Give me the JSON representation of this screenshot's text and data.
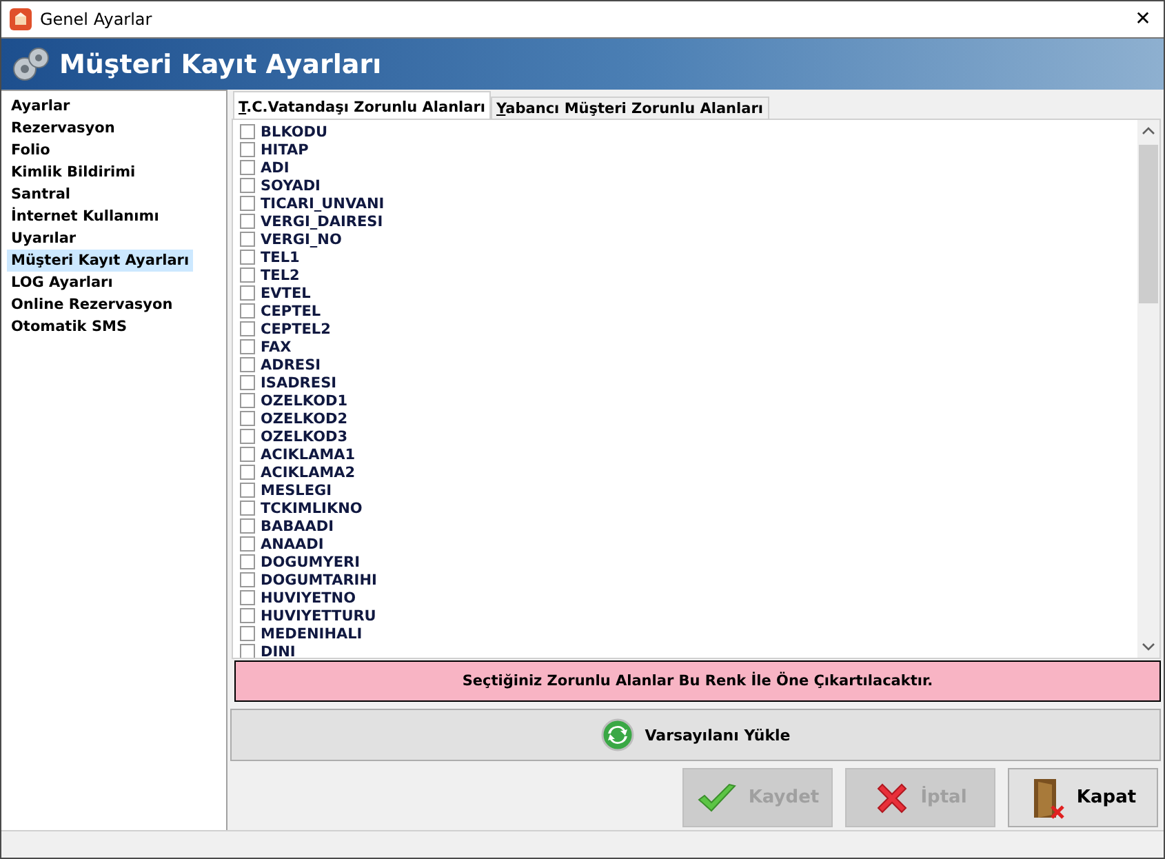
{
  "window": {
    "title": "Genel Ayarlar",
    "close": "✕"
  },
  "header": {
    "title": "Müşteri Kayıt Ayarları"
  },
  "sidebar": {
    "items": [
      {
        "label": "Ayarlar",
        "selected": false
      },
      {
        "label": "Rezervasyon",
        "selected": false
      },
      {
        "label": "Folio",
        "selected": false
      },
      {
        "label": "Kimlik Bildirimi",
        "selected": false
      },
      {
        "label": "Santral",
        "selected": false
      },
      {
        "label": "İnternet Kullanımı",
        "selected": false
      },
      {
        "label": "Uyarılar",
        "selected": false
      },
      {
        "label": "Müşteri Kayıt Ayarları",
        "selected": true
      },
      {
        "label": "LOG Ayarları",
        "selected": false
      },
      {
        "label": "Online Rezervasyon",
        "selected": false
      },
      {
        "label": "Otomatik SMS",
        "selected": false
      }
    ]
  },
  "tabs": [
    {
      "label": "T.C.Vatandaşı Zorunlu Alanları",
      "selected": true
    },
    {
      "label": "Yabancı Müşteri Zorunlu Alanları",
      "selected": false
    }
  ],
  "fields": [
    {
      "label": "BLKODU",
      "checked": false
    },
    {
      "label": "HITAP",
      "checked": false
    },
    {
      "label": "ADI",
      "checked": false
    },
    {
      "label": "SOYADI",
      "checked": false
    },
    {
      "label": "TICARI_UNVANI",
      "checked": false
    },
    {
      "label": "VERGI_DAIRESI",
      "checked": false
    },
    {
      "label": "VERGI_NO",
      "checked": false
    },
    {
      "label": "TEL1",
      "checked": false
    },
    {
      "label": "TEL2",
      "checked": false
    },
    {
      "label": "EVTEL",
      "checked": false
    },
    {
      "label": "CEPTEL",
      "checked": false
    },
    {
      "label": "CEPTEL2",
      "checked": false
    },
    {
      "label": "FAX",
      "checked": false
    },
    {
      "label": "ADRESI",
      "checked": false
    },
    {
      "label": "ISADRESI",
      "checked": false
    },
    {
      "label": "OZELKOD1",
      "checked": false
    },
    {
      "label": "OZELKOD2",
      "checked": false
    },
    {
      "label": "OZELKOD3",
      "checked": false
    },
    {
      "label": "ACIKLAMA1",
      "checked": false
    },
    {
      "label": "ACIKLAMA2",
      "checked": false
    },
    {
      "label": "MESLEGI",
      "checked": false
    },
    {
      "label": "TCKIMLIKNO",
      "checked": false
    },
    {
      "label": "BABAADI",
      "checked": false
    },
    {
      "label": "ANAADI",
      "checked": false
    },
    {
      "label": "DOGUMYERI",
      "checked": false
    },
    {
      "label": "DOGUMTARIHI",
      "checked": false
    },
    {
      "label": "HUVIYETNO",
      "checked": false
    },
    {
      "label": "HUVIYETTURU",
      "checked": false
    },
    {
      "label": "MEDENIHALI",
      "checked": false
    },
    {
      "label": "DINI",
      "checked": false
    }
  ],
  "highlight_note": "Seçtiğiniz Zorunlu Alanlar Bu Renk İle Öne Çıkartılacaktır.",
  "load_defaults_button": "Varsayılanı Yükle",
  "buttons": [
    {
      "label": "Kaydet",
      "kind": "save",
      "disabled": true
    },
    {
      "label": "İptal",
      "kind": "cancel",
      "disabled": true
    },
    {
      "label": "Kapat",
      "kind": "close",
      "disabled": false
    }
  ]
}
